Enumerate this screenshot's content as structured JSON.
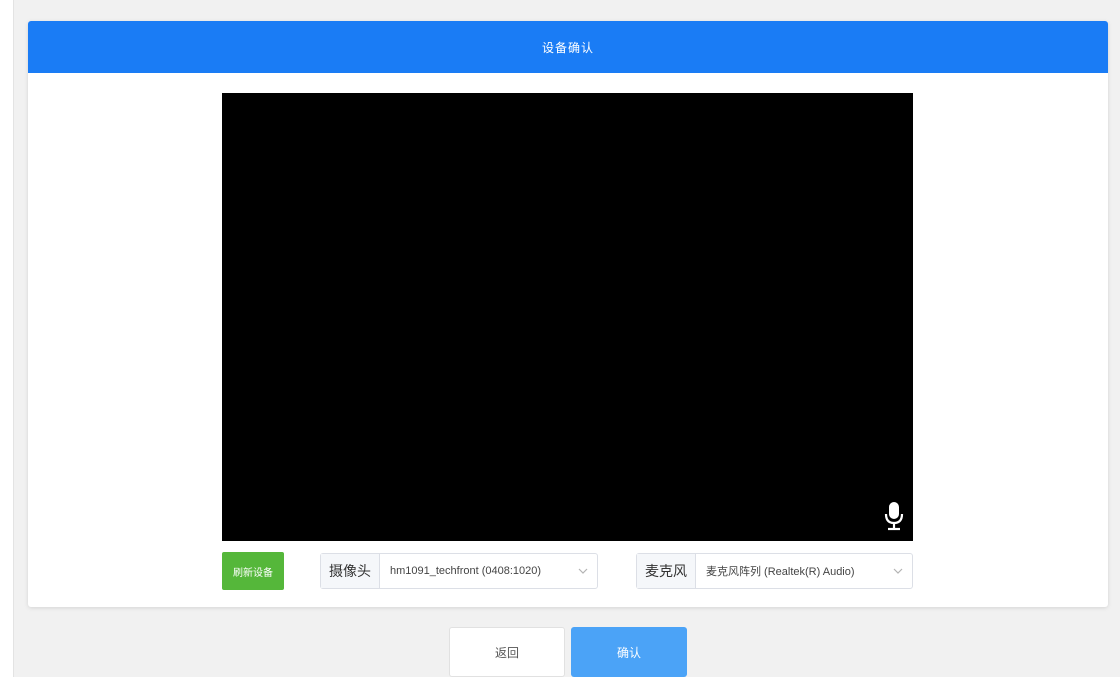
{
  "dialog": {
    "title": "设备确认"
  },
  "video": {
    "mic_icon": "microphone-icon"
  },
  "controls": {
    "refresh_label": "刷新设备",
    "camera": {
      "label": "摄像头",
      "value": "hm1091_techfront (0408:1020)"
    },
    "microphone": {
      "label": "麦克风",
      "value": "麦克风阵列 (Realtek(R) Audio)"
    }
  },
  "footer": {
    "back_label": "返回",
    "confirm_label": "确认"
  },
  "colors": {
    "header_blue": "#1a7cf5",
    "refresh_green": "#55b73a",
    "confirm_blue": "#4ba3f7"
  }
}
